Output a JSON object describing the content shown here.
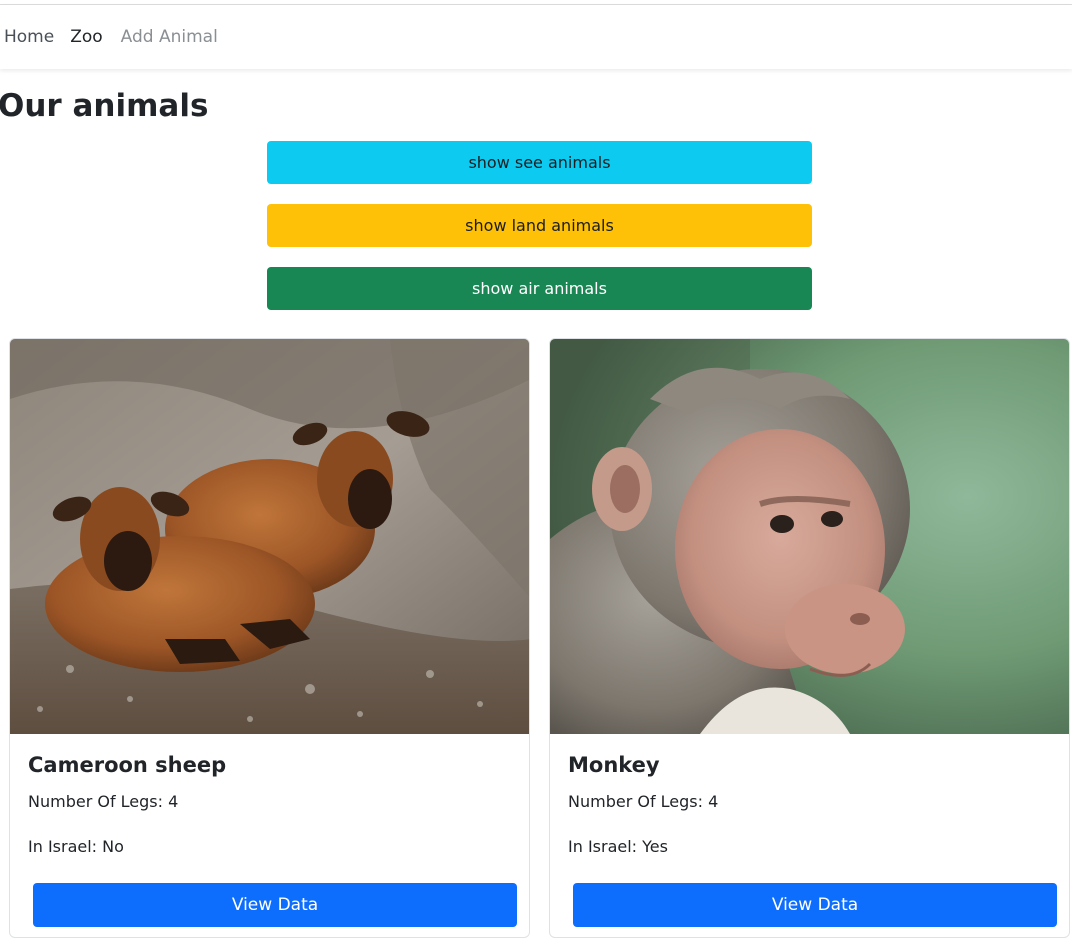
{
  "nav": {
    "home": "Home",
    "zoo": "Zoo",
    "add_animal": "Add Animal"
  },
  "page": {
    "title": "Our animals"
  },
  "filters": {
    "sea": "show see animals",
    "land": "show land animals",
    "air": "show air animals"
  },
  "colors": {
    "sea": "#0dcaf0",
    "land": "#ffc107",
    "air": "#198754",
    "primary": "#0d6efd"
  },
  "animals": [
    {
      "name": "Cameroon sheep",
      "legs": "Number Of Legs: 4",
      "israel": "In Israel: No",
      "button": "View Data"
    },
    {
      "name": "Monkey",
      "legs": "Number Of Legs: 4",
      "israel": "In Israel: Yes",
      "button": "View Data"
    }
  ]
}
